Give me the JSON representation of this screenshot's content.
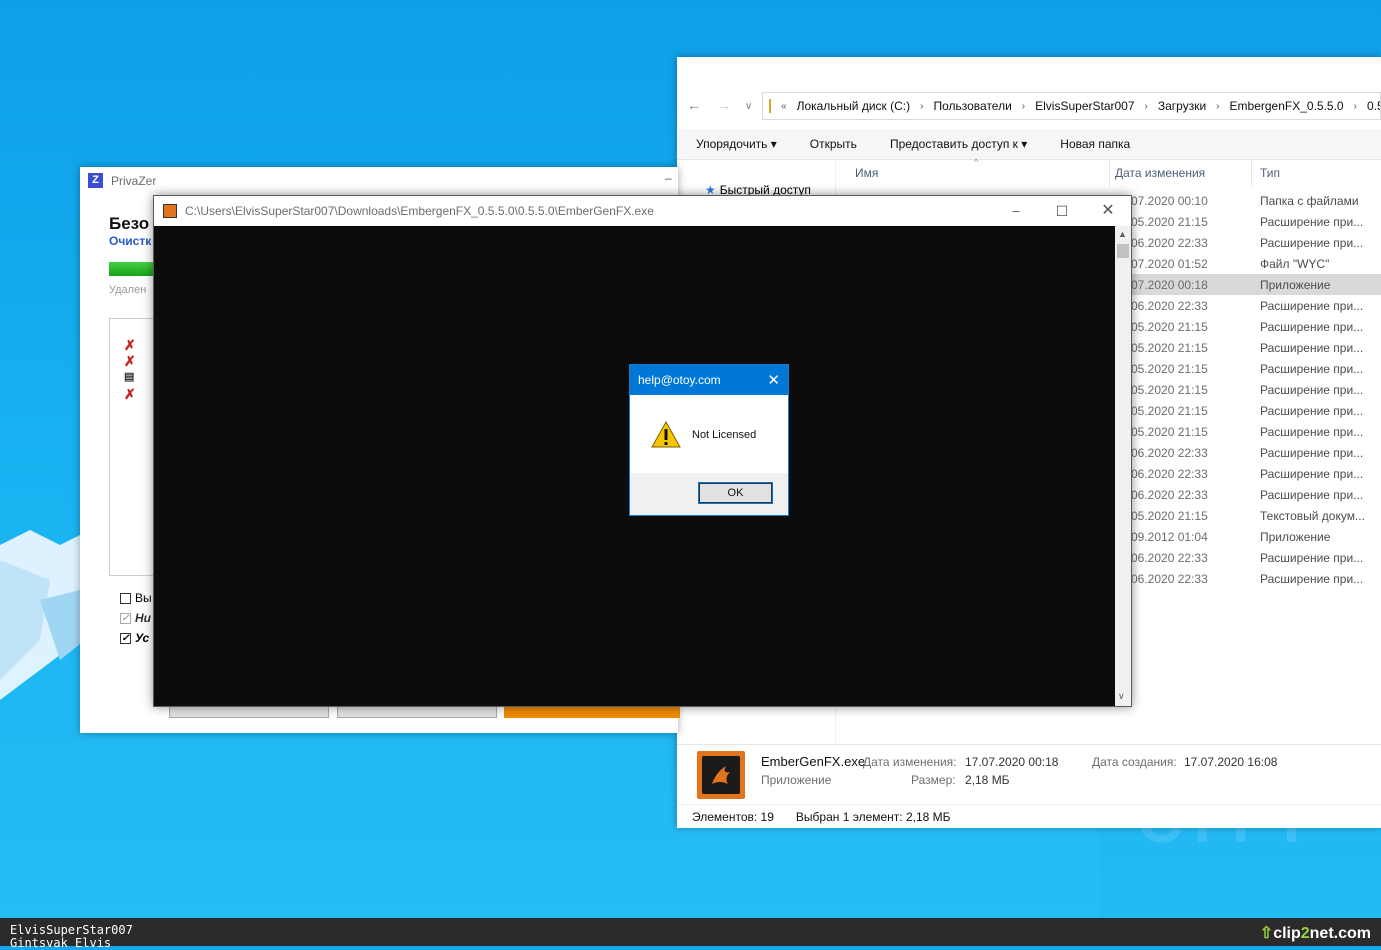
{
  "explorer": {
    "breadcrumbs": [
      "Локальный диск (C:)",
      "Пользователи",
      "ElvisSuperStar007",
      "Загрузки",
      "EmbergenFX_0.5.5.0",
      "0.5.5.0"
    ],
    "toolbar": [
      "Упорядочить",
      "Открыть",
      "Предоставить доступ к",
      "Новая папка"
    ],
    "sidebar_quick": "Быстрый доступ",
    "columns": {
      "name": "Имя",
      "date": "Дата изменения",
      "type": "Тип"
    },
    "rows": [
      {
        "date": "07.2020 00:10",
        "type": "Папка с файлами"
      },
      {
        "date": "05.2020 21:15",
        "type": "Расширение при..."
      },
      {
        "date": "06.2020 22:33",
        "type": "Расширение при..."
      },
      {
        "date": "07.2020 01:52",
        "type": "Файл \"WYC\""
      },
      {
        "date": "07.2020 00:18",
        "type": "Приложение"
      },
      {
        "date": "06.2020 22:33",
        "type": "Расширение при..."
      },
      {
        "date": "05.2020 21:15",
        "type": "Расширение при..."
      },
      {
        "date": "05.2020 21:15",
        "type": "Расширение при..."
      },
      {
        "date": "05.2020 21:15",
        "type": "Расширение при..."
      },
      {
        "date": "05.2020 21:15",
        "type": "Расширение при..."
      },
      {
        "date": "05.2020 21:15",
        "type": "Расширение при..."
      },
      {
        "date": "05.2020 21:15",
        "type": "Расширение при..."
      },
      {
        "date": "06.2020 22:33",
        "type": "Расширение при..."
      },
      {
        "date": "06.2020 22:33",
        "type": "Расширение при..."
      },
      {
        "date": "06.2020 22:33",
        "type": "Расширение при..."
      },
      {
        "date": "05.2020 21:15",
        "type": "Текстовый докум..."
      },
      {
        "date": "09.2012 01:04",
        "type": "Приложение"
      },
      {
        "date": "06.2020 22:33",
        "type": "Расширение при..."
      },
      {
        "date": "06.2020 22:33",
        "type": "Расширение при..."
      }
    ],
    "details": {
      "filename": "EmberGenFX.exe",
      "kind": "Приложение",
      "modified_label": "Дата изменения:",
      "modified": "17.07.2020 00:18",
      "size_label": "Размер:",
      "size": "2,18 МБ",
      "created_label": "Дата создания:",
      "created": "17.07.2020 16:08"
    },
    "status": {
      "count": "Элементов: 19",
      "selected": "Выбран 1 элемент: 2,18 МБ"
    }
  },
  "privazer": {
    "title": "PrivaZer",
    "heading": "Безо",
    "subheading": "Очистк",
    "deleting": "Удален",
    "cb1": "Вы",
    "cb2": "Ни",
    "cb3": "Ус"
  },
  "console": {
    "path": "C:\\Users\\ElvisSuperStar007\\Downloads\\EmbergenFX_0.5.5.0\\0.5.5.0\\EmberGenFX.exe"
  },
  "dialog": {
    "title": "help@otoy.com",
    "message": "Not Licensed",
    "ok": "OK"
  },
  "overlay": {
    "user_line1": "ElvisSuperStar007",
    "user_line2": "Gintsvak Elvis",
    "watermark_a": "clip",
    "watermark_b": "2",
    "watermark_c": "net.com"
  }
}
